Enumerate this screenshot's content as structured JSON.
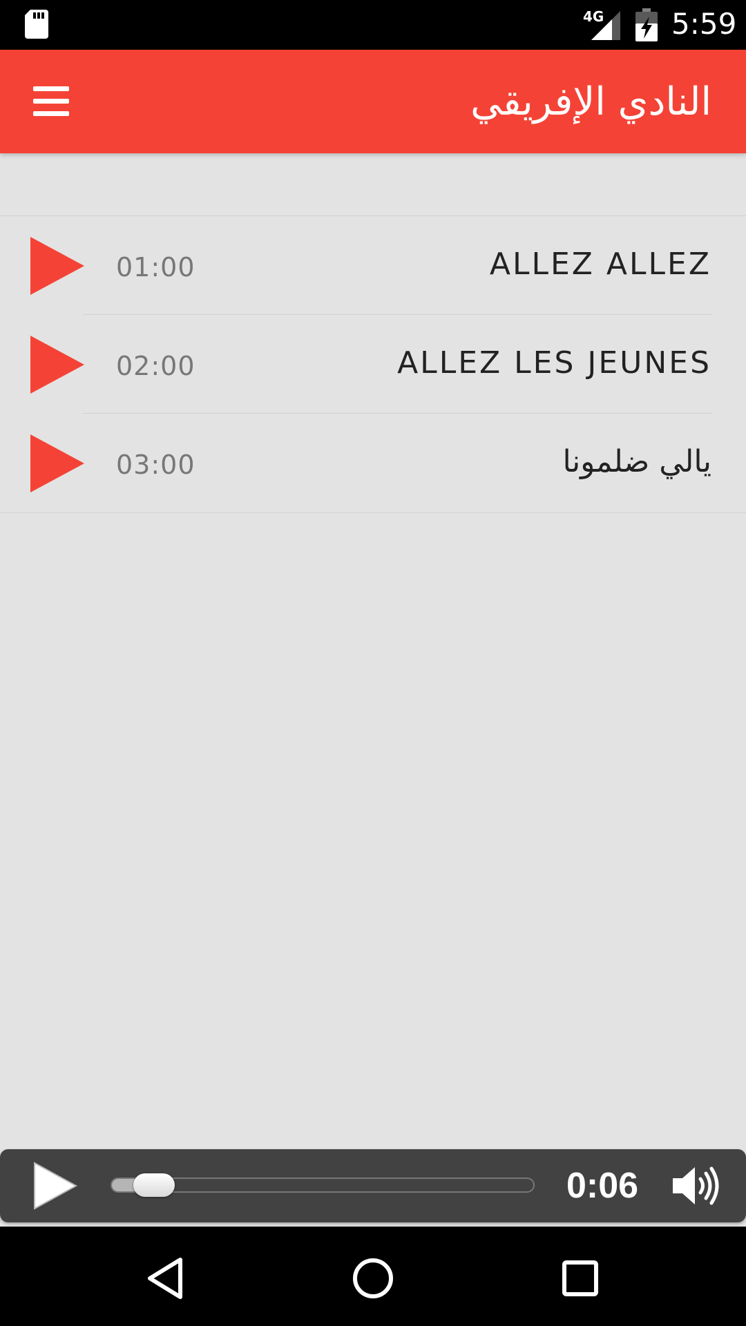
{
  "status_bar": {
    "network_label": "4G",
    "time": "5:59"
  },
  "app_bar": {
    "title": "النادي الإفريقي",
    "menu_icon": "hamburger-menu-icon"
  },
  "tracks": [
    {
      "title": "ALLEZ ALLEZ",
      "duration": "01:00"
    },
    {
      "title": "ALLEZ LES JEUNES",
      "duration": "02:00"
    },
    {
      "title": "يالي ضلمونا",
      "duration": "03:00"
    }
  ],
  "player": {
    "elapsed": "0:06",
    "progress": 0.1
  },
  "colors": {
    "accent": "#f44336",
    "background": "#e3e3e3",
    "player_background": "#424242"
  }
}
